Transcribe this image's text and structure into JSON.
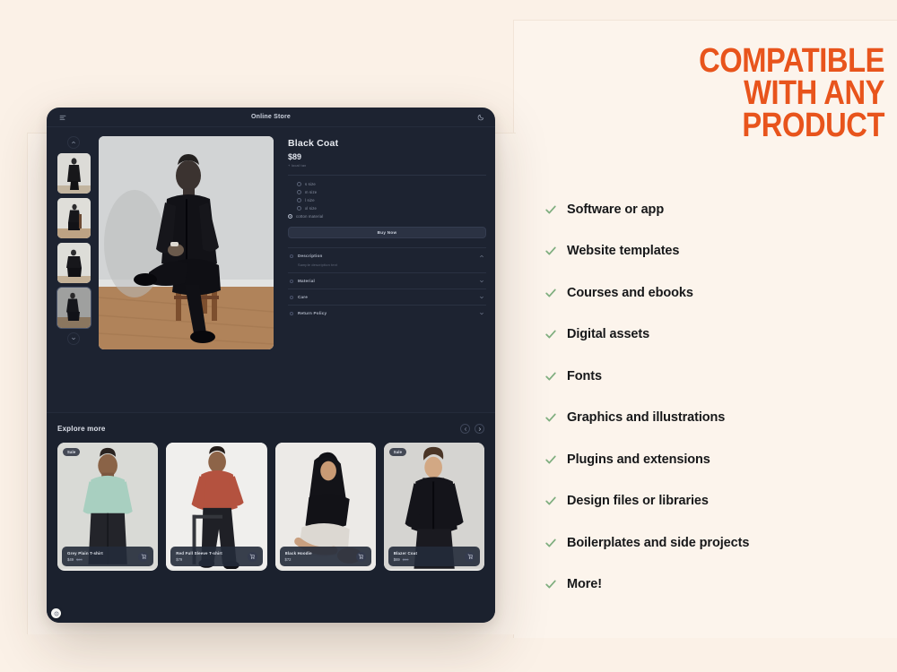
{
  "theme": {
    "page_bg": "#fbf1e7",
    "panel_bg": "#fcf4ec",
    "app_bg": "#1d2331",
    "app_bg_alt": "#1b212e",
    "accent_orange": "#e8541c",
    "check_green": "#7fae7f",
    "text_dark": "#17181a",
    "text_light": "#e7eaf0"
  },
  "app": {
    "title": "Online Store",
    "menu_icon": "menu-icon",
    "theme_toggle_icon": "moon-icon",
    "corner_badge": "info-badge"
  },
  "gallery": {
    "up_icon": "chevron-up-icon",
    "down_icon": "chevron-down-icon",
    "thumbnails": [
      {
        "alt": "Model standing in black coat"
      },
      {
        "alt": "Model seated on chair in black suit"
      },
      {
        "alt": "Model crouching in black outfit"
      },
      {
        "alt": "Model seated wearing black coat"
      }
    ],
    "hero": {
      "alt": "Man in black coat seated on wooden chair"
    }
  },
  "product": {
    "name": "Black Coat",
    "price": "$89",
    "tax_note": "+ local tax",
    "options": [
      {
        "label": "s size",
        "selected": false
      },
      {
        "label": "m size",
        "selected": false
      },
      {
        "label": "l size",
        "selected": false
      },
      {
        "label": "xl size",
        "selected": false
      },
      {
        "label": "cotton material",
        "selected": true
      }
    ],
    "buy_label": "Buy Now",
    "accordion": [
      {
        "label": "Description",
        "expanded": true,
        "body": "Sample description text"
      },
      {
        "label": "Material",
        "expanded": false,
        "body": ""
      },
      {
        "label": "Care",
        "expanded": false,
        "body": ""
      },
      {
        "label": "Return Policy",
        "expanded": false,
        "body": ""
      }
    ]
  },
  "explore": {
    "title": "Explore more",
    "prev_icon": "chevron-left-circle-icon",
    "next_icon": "chevron-right-circle-icon",
    "cart_icon": "cart-icon",
    "badge_label": "Sale",
    "cards": [
      {
        "name": "Grey Plain T-shirt",
        "price": "$49",
        "old_price": "$69",
        "badge": "Sale",
        "alt": "Man in mint t-shirt"
      },
      {
        "name": "Red Full Sleeve T-shirt",
        "price": "$79",
        "old_price": "",
        "badge": "",
        "alt": "Man in red sweater on stool"
      },
      {
        "name": "Black Hoodie",
        "price": "$72",
        "old_price": "",
        "badge": "",
        "alt": "Woman in black hoodie"
      },
      {
        "name": "Blazer Coat",
        "price": "$69",
        "old_price": "$99",
        "badge": "Sale",
        "alt": "Woman in black blazer"
      }
    ]
  },
  "promo": {
    "headline_lines": [
      "COMPATIBLE",
      "WITH ANY",
      "PRODUCT"
    ],
    "check_icon": "check-icon",
    "items": [
      "Software or app",
      "Website templates",
      "Courses and ebooks",
      "Digital assets",
      "Fonts",
      "Graphics and illustrations",
      "Plugins and extensions",
      "Design files or libraries",
      "Boilerplates and side projects",
      "More!"
    ]
  }
}
